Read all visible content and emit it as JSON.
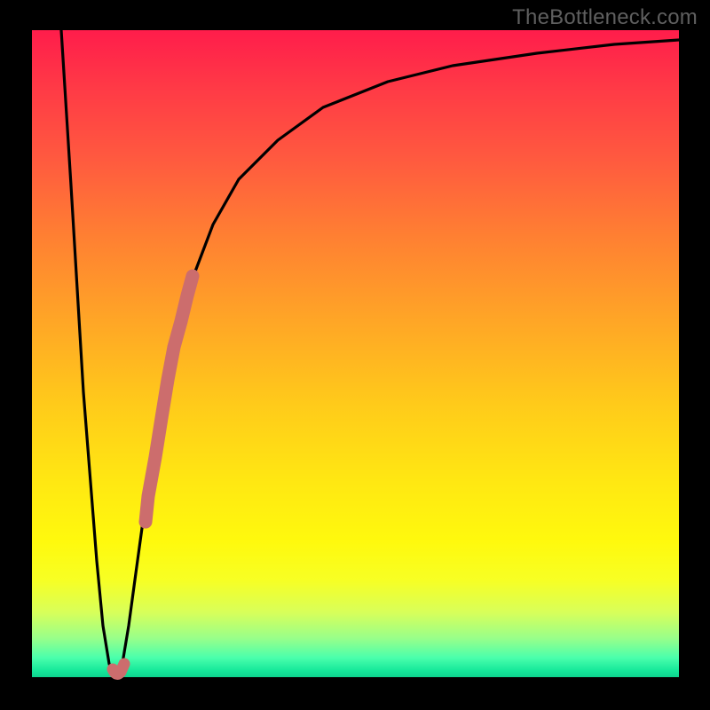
{
  "watermark": "TheBottleneck.com",
  "colors": {
    "frame": "#000000",
    "curve": "#000000",
    "marker": "#cc6d6d"
  },
  "chart_data": {
    "type": "line",
    "title": "",
    "xlabel": "",
    "ylabel": "",
    "xlim": [
      0,
      100
    ],
    "ylim": [
      0,
      100
    ],
    "series": [
      {
        "name": "bottleneck-curve",
        "x": [
          4.5,
          6,
          8,
          10,
          11,
          12,
          13,
          14,
          15,
          16,
          18,
          20,
          22,
          25,
          28,
          32,
          38,
          45,
          55,
          65,
          78,
          90,
          100
        ],
        "values": [
          100,
          76,
          44,
          18,
          8,
          2,
          0,
          2,
          8,
          16,
          30,
          42,
          52,
          62,
          70,
          77,
          83,
          88,
          92,
          94.5,
          96.5,
          97.8,
          98.5
        ]
      },
      {
        "name": "highlighted-segment",
        "x": [
          12.5,
          13,
          13.4,
          14,
          17.5,
          18,
          19,
          20,
          21,
          22,
          23,
          24,
          24.8
        ],
        "values": [
          1.2,
          0.4,
          0.2,
          1,
          24,
          28,
          34,
          40,
          46,
          51,
          55,
          59,
          62
        ]
      }
    ],
    "annotations": []
  }
}
